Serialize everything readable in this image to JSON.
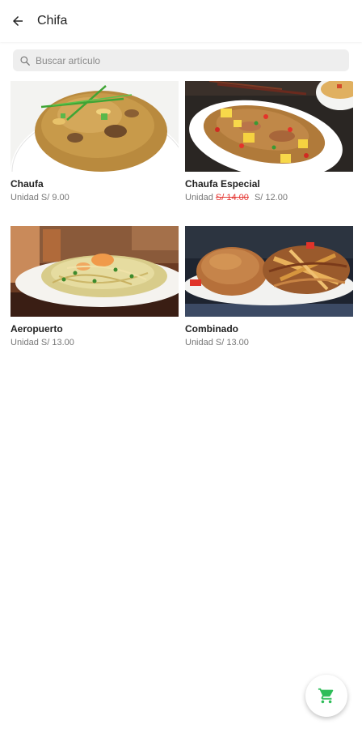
{
  "header": {
    "title": "Chifa",
    "back_icon": "arrow-left-icon"
  },
  "search": {
    "placeholder": "Buscar artículo",
    "value": "",
    "icon": "search-icon"
  },
  "products": [
    {
      "name": "Chaufa",
      "unit": "Unidad",
      "old_price": "",
      "price": "S/ 9.00"
    },
    {
      "name": "Chaufa Especial",
      "unit": "Unidad",
      "old_price": "S/ 14.00",
      "price": "S/ 12.00"
    },
    {
      "name": "Aeropuerto",
      "unit": "Unidad",
      "old_price": "",
      "price": "S/ 13.00"
    },
    {
      "name": "Combinado",
      "unit": "Unidad",
      "old_price": "",
      "price": "S/ 13.00"
    }
  ],
  "cart_button": {
    "icon": "cart-icon"
  },
  "colors": {
    "accent": "#2ebd59",
    "old_price": "#e53935",
    "search_bg": "#eeeeee"
  }
}
